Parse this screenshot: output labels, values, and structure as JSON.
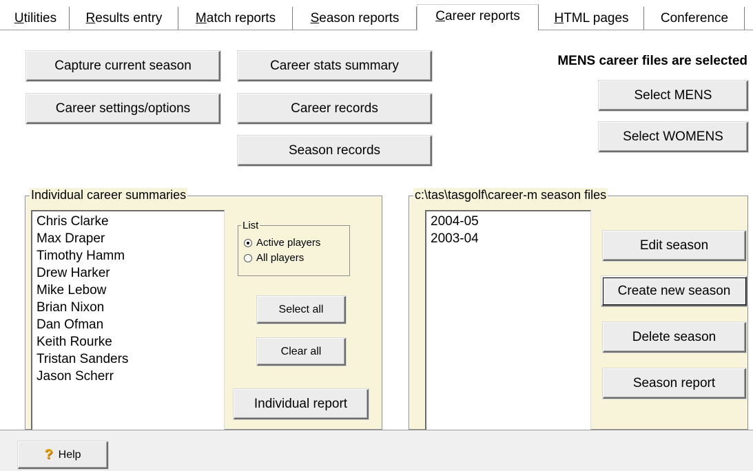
{
  "tabs": [
    {
      "pre": "",
      "u": "U",
      "post": "tilities"
    },
    {
      "pre": "",
      "u": "R",
      "post": "esults entry"
    },
    {
      "pre": "",
      "u": "M",
      "post": "atch reports"
    },
    {
      "pre": "",
      "u": "S",
      "post": "eason reports"
    },
    {
      "pre": "",
      "u": "C",
      "post": "areer reports"
    },
    {
      "pre": "",
      "u": "H",
      "post": "TML pages"
    },
    {
      "pre": "Conference",
      "u": "",
      "post": ""
    }
  ],
  "buttons": {
    "capture": "Capture current season",
    "career_settings": "Career settings/options",
    "stats_summary": "Career stats summary",
    "career_records": "Career records",
    "season_records": "Season records",
    "select_mens": "Select MENS",
    "select_womens": "Select WOMENS"
  },
  "status_text": "MENS career files are selected",
  "individual": {
    "title": "Individual career summaries",
    "players": [
      "Chris Clarke",
      "Max Draper",
      "Timothy Hamm",
      "Drew Harker",
      "Mike Lebow",
      "Brian Nixon",
      "Dan Ofman",
      "Keith Rourke",
      "Tristan Sanders",
      "Jason Scherr"
    ],
    "list_title": "List",
    "radio_active": "Active players",
    "radio_all": "All players",
    "select_all": "Select all",
    "clear_all": "Clear all",
    "report": "Individual report"
  },
  "season_files": {
    "title": "c:\\tas\\tasgolf\\career-m season files",
    "seasons": [
      "2004-05",
      "2003-04"
    ],
    "edit": "Edit season",
    "create": "Create new season",
    "delete": "Delete season",
    "report": "Season report"
  },
  "help": {
    "icon": "question-icon",
    "icon_glyph": "?",
    "label": "Help"
  }
}
